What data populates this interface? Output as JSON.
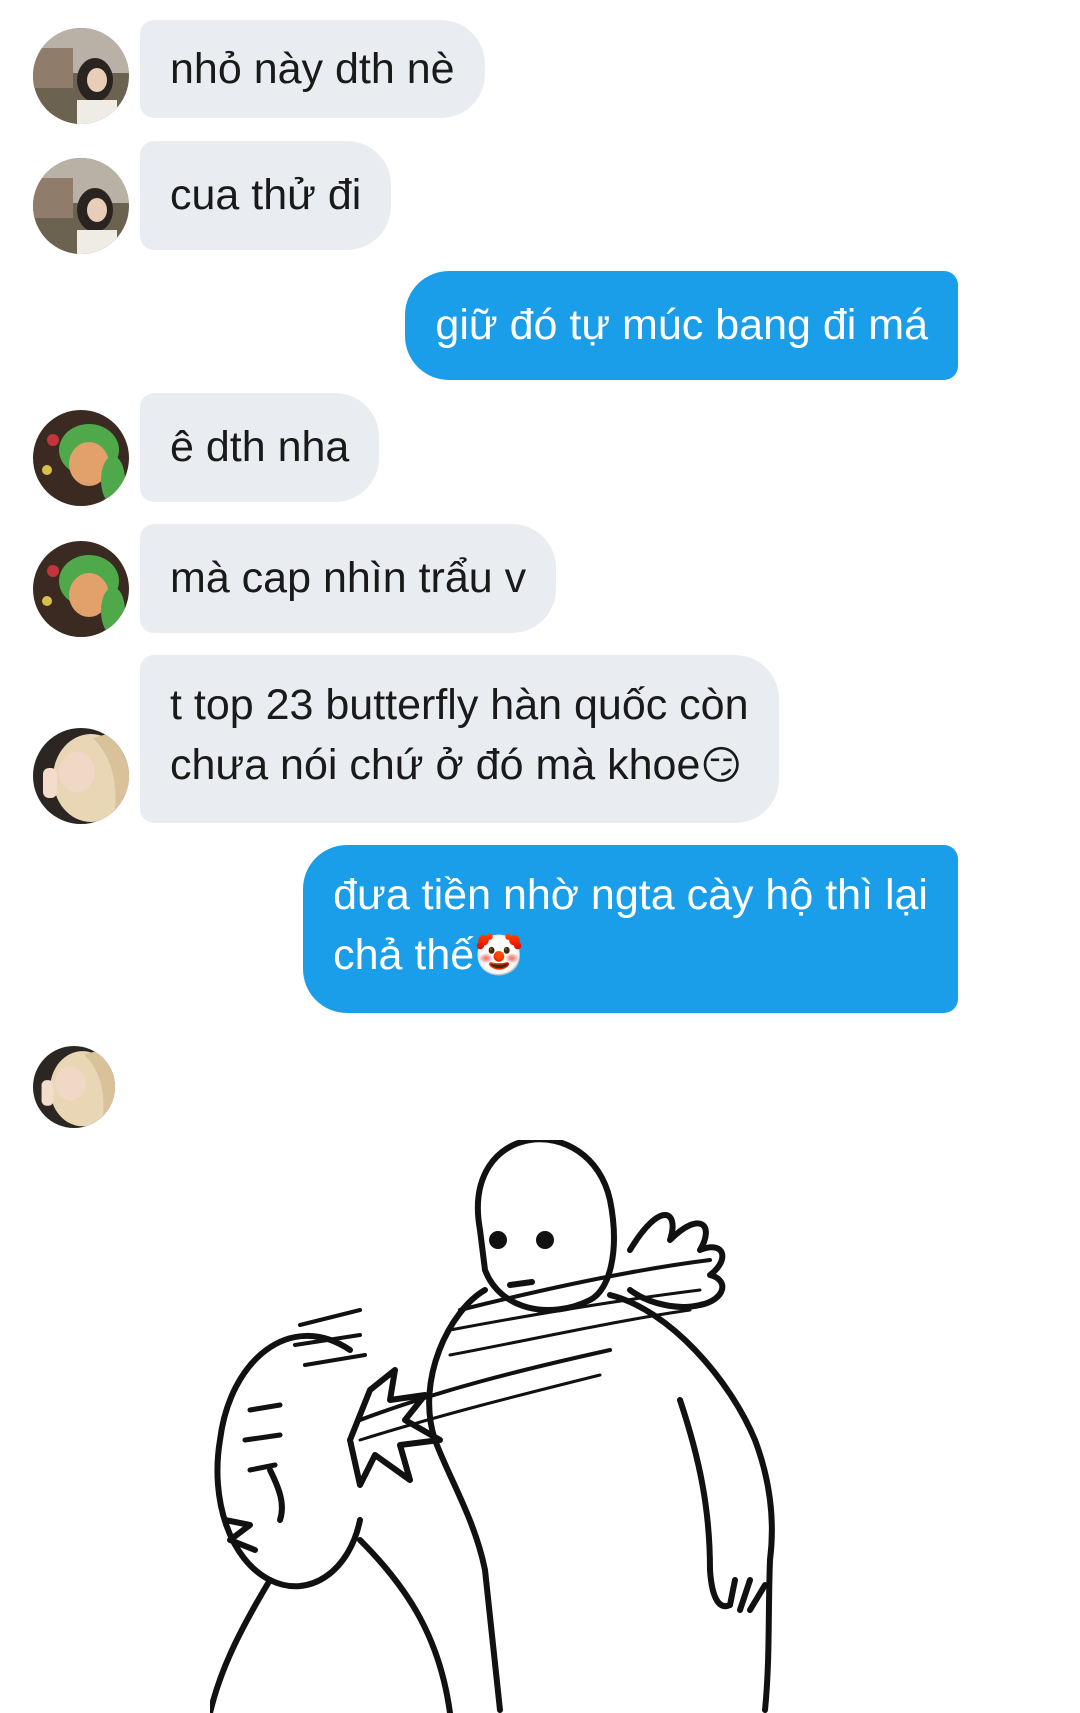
{
  "messages": [
    {
      "sender": "them",
      "avatar": "girl-avatar",
      "text": "nhỏ này dth nè"
    },
    {
      "sender": "them",
      "avatar": "girl-avatar",
      "text": "cua thử đi"
    },
    {
      "sender": "me",
      "text": "giữ đó tự múc bang đi má"
    },
    {
      "sender": "them",
      "avatar": "green-hair-avatar",
      "text": "ê dth nha"
    },
    {
      "sender": "them",
      "avatar": "green-hair-avatar",
      "text": "mà cap nhìn trẩu v"
    },
    {
      "sender": "them",
      "avatar": "blonde-avatar",
      "line1": "t top 23 butterfly hàn quốc còn",
      "line2": "chưa nói chứ ở đó mà khoe",
      "emoji": "😏"
    },
    {
      "sender": "me",
      "line1": "đưa tiền nhờ ngta cày hộ thì lại",
      "line2": "chả thế",
      "emoji": "🤡"
    },
    {
      "sender": "them",
      "avatar": "blonde-avatar",
      "sticker": "slap-meme-sticker"
    }
  ],
  "colors": {
    "incoming_bubble": "#e9edf1",
    "outgoing_bubble": "#1b9ee9",
    "text_dark": "#1a1a1a",
    "text_light": "#ffffff"
  }
}
